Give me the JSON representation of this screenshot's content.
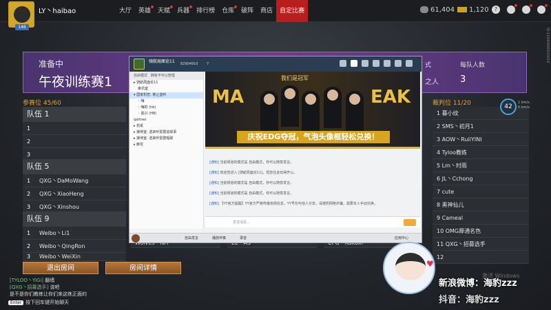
{
  "user": {
    "name": "LY丶haibao",
    "level": "146"
  },
  "nav": [
    "大厅",
    "英雄",
    "天赋",
    "兵器",
    "排行榜",
    "仓库",
    "破阵",
    "商店",
    "自定比赛"
  ],
  "nav_active": "自定比赛",
  "currency": {
    "silver": "61,404",
    "gold": "1,120"
  },
  "top_icons": [
    "help-icon",
    "mail-icon",
    "settings-icon",
    "menu-icon"
  ],
  "room": {
    "status": "准备中",
    "name": "午夜训练赛1",
    "partial_label_1": "式",
    "partial_label_2": "之人",
    "per_team_label": "每队人数",
    "per_team_value": "3"
  },
  "slots": {
    "label": "参赛位",
    "count": "45/60"
  },
  "referee": {
    "label": "裁判位",
    "count": "11/20",
    "list": [
      "1 暮小纹",
      "2 SMS丶初月1",
      "3 AOW丶RuiiYINI",
      "4 Tyloo教练",
      "5 Lm丶时雨",
      "6 JL丶Cchong",
      "7 cute",
      "8 黑神仙儿",
      "9 Cameal",
      "10 OMG靡通名色",
      "11 QXG丶招募选手",
      "12"
    ]
  },
  "ping": {
    "value": "42",
    "lines": [
      "1 km/s",
      "0 km/s"
    ]
  },
  "teams": [
    {
      "name": "队伍 1",
      "rows": [
        [
          "1",
          ""
        ],
        [
          "2",
          ""
        ],
        [
          "3",
          ""
        ]
      ]
    },
    {
      "name": "队伍 5",
      "rows": [
        [
          "1",
          "QXG丶DaMoWang"
        ],
        [
          "2",
          "QXG丶XiaoHeng"
        ],
        [
          "3",
          "QXG丶Xinshou"
        ]
      ]
    },
    {
      "name": "队伍 9",
      "rows": [
        [
          "1",
          "Weibo丶Li1"
        ],
        [
          "2",
          "Weibo丶QingRon"
        ],
        [
          "3",
          "Weibo丶WeiXin"
        ]
      ]
    }
  ],
  "hidden_row_texts": [
    "Wolves丶NH",
    "EL丶AS",
    "CPG丶Kakaxi"
  ],
  "buttons": {
    "exit": "退出房间",
    "detail": "房间详情"
  },
  "chat": [
    {
      "tag": "[TYLOO丶YiGi]",
      "text": "翻墙"
    },
    {
      "tag": "[QXG丶招募选手]",
      "text": "说吧"
    },
    {
      "tag": "",
      "text": "是不是你们教练让你们来这练正面的"
    }
  ],
  "enter_hint": {
    "key": "Enter",
    "text": "按下回车键开始聊天"
  },
  "yy": {
    "title": "骑航局面论11",
    "id": "82904910",
    "users": "7",
    "left_head": "自由模式",
    "left_tag": "拥有不可以管理",
    "channels": [
      {
        "text": "▸ 骑航局面论11",
        "sel": false,
        "sub": false
      },
      {
        "text": "审讯室",
        "sel": false,
        "sub": true
      },
      {
        "text": "▾ 国家机密: 禁止监听",
        "sel": true,
        "sub": false
      },
      {
        "text": "◦ 嗨",
        "sel": false,
        "sub": true
      },
      {
        "text": "◦ 嗨的 (hb)",
        "sel": false,
        "sub": true
      },
      {
        "text": "◦ 嘉兴 (HB)",
        "sel": false,
        "sub": true
      },
      {
        "text": "qaltnes",
        "sel": false,
        "sub": false
      },
      {
        "text": "▸ 抗纸",
        "sel": false,
        "sub": false
      },
      {
        "text": "▸ 接待室: 送来听雷霆说故事",
        "sel": false,
        "sub": false
      },
      {
        "text": "▸ 接待室: 送来听雷霆唱歌",
        "sel": false,
        "sub": false
      },
      {
        "text": "▸ 献花",
        "sel": false,
        "sub": false
      }
    ],
    "promo_top": "我们是冠军",
    "promo_left": "MA",
    "promo_right": "EAK",
    "promo_banner": "庆祝EDG夺冠，气泡头像框轻松兑换！",
    "notices": [
      {
        "tag": "[通知]",
        "text": "当前频道的模式是 自由模式，你可以随意发言。"
      },
      {
        "tag": "[通知]",
        "text": "欢迎您进入 [骑航局面论11]，祝您在此玩得开心。"
      },
      {
        "tag": "[通知]",
        "text": "当前频道的模式是 自由模式，你可以随意发言。"
      },
      {
        "tag": "[通知]",
        "text": "当前频道的模式是 自由模式，你可以随意发言。"
      },
      {
        "tag": "[通知]",
        "text": "【YY官方提醒】YY官方严禁传播违规信息，YY号勿与他人分享，请谨防网络诈骗，需要本人手动兑换。"
      }
    ],
    "input_placeholder": "发送消息...",
    "bottom": [
      "自由发言",
      "播放伴奏",
      "录音",
      "应用中心"
    ]
  },
  "streamer": {
    "weibo": "新浪微博：海豹zzz",
    "weibo2": "抖音：海豹zzz",
    "watermark": "激活 Windows"
  },
  "vertical_id": "ID:1154000001001E"
}
